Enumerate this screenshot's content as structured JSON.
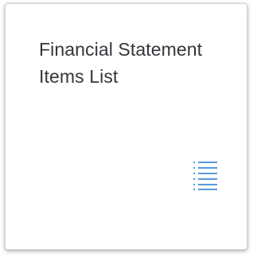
{
  "tile": {
    "title_line1": "Financial Statement",
    "title_line2": "Items List",
    "icon": "list-icon",
    "icon_color": "#5899da"
  }
}
